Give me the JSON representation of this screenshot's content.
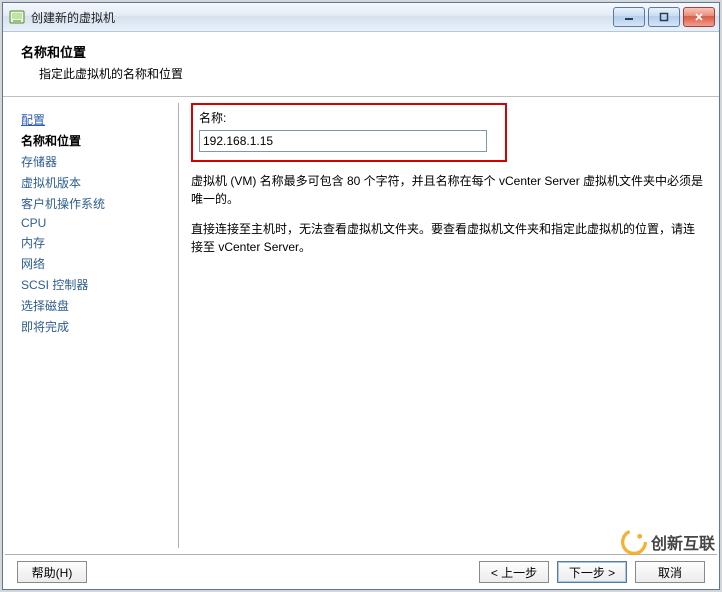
{
  "window": {
    "title": "创建新的虚拟机"
  },
  "header": {
    "title": "名称和位置",
    "subtitle": "指定此虚拟机的名称和位置"
  },
  "sidebar": {
    "items": [
      {
        "label": "配置",
        "link": true
      },
      {
        "label": "名称和位置",
        "current": true
      },
      {
        "label": "存储器"
      },
      {
        "label": "虚拟机版本"
      },
      {
        "label": "客户机操作系统"
      },
      {
        "label": "CPU"
      },
      {
        "label": "内存"
      },
      {
        "label": "网络"
      },
      {
        "label": "SCSI 控制器"
      },
      {
        "label": "选择磁盘"
      },
      {
        "label": "即将完成"
      }
    ]
  },
  "main": {
    "name_label": "名称:",
    "name_value": "192.168.1.15",
    "desc1": "虚拟机 (VM) 名称最多可包含 80 个字符，并且名称在每个 vCenter Server 虚拟机文件夹中必须是唯一的。",
    "desc2": "直接连接至主机时，无法查看虚拟机文件夹。要查看虚拟机文件夹和指定此虚拟机的位置，请连接至 vCenter Server。"
  },
  "footer": {
    "help": "帮助(H)",
    "back": "< 上一步",
    "next": "下一步 >",
    "cancel": "取消"
  },
  "watermark": {
    "text": "创新互联"
  }
}
